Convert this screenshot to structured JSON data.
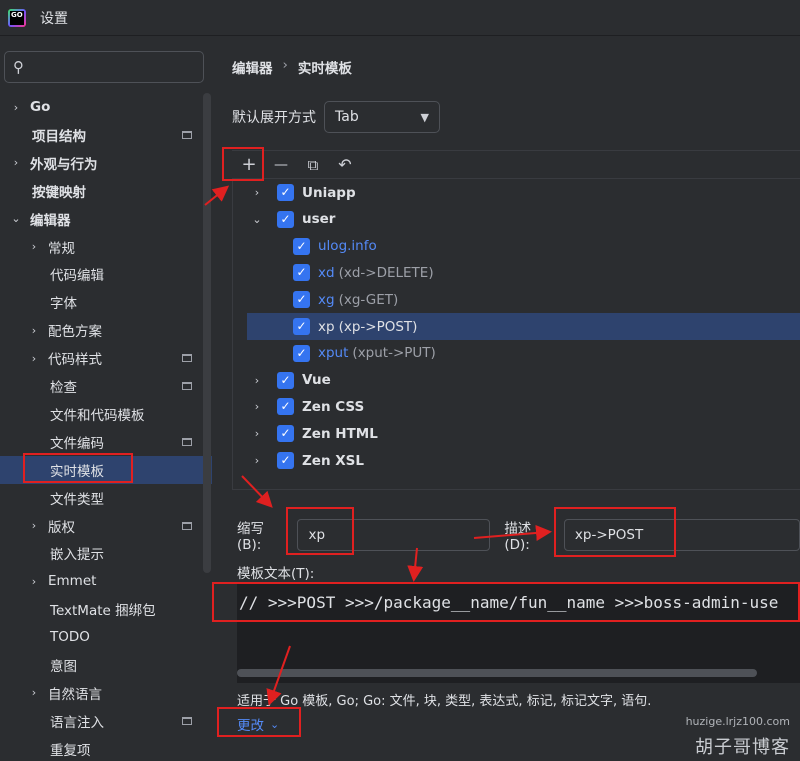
{
  "window": {
    "title": "设置",
    "logo_text": "GO"
  },
  "sidebar": {
    "search_placeholder": "",
    "items": [
      {
        "label": "Go",
        "bold": true,
        "chevron": "›"
      },
      {
        "label": "项目结构",
        "bold": true
      },
      {
        "label": "外观与行为",
        "bold": true,
        "chevron": "›"
      },
      {
        "label": "按键映射",
        "bold": true
      },
      {
        "label": "编辑器",
        "bold": true,
        "chevron": "⌄"
      },
      {
        "label": "常规",
        "chevron": "›"
      },
      {
        "label": "代码编辑"
      },
      {
        "label": "字体"
      },
      {
        "label": "配色方案",
        "chevron": "›"
      },
      {
        "label": "代码样式",
        "chevron": "›"
      },
      {
        "label": "检查"
      },
      {
        "label": "文件和代码模板"
      },
      {
        "label": "文件编码"
      },
      {
        "label": "实时模板"
      },
      {
        "label": "文件类型"
      },
      {
        "label": "版权",
        "chevron": "›"
      },
      {
        "label": "嵌入提示"
      },
      {
        "label": "Emmet",
        "chevron": "›"
      },
      {
        "label": "TextMate 捆绑包"
      },
      {
        "label": "TODO"
      },
      {
        "label": "意图"
      },
      {
        "label": "自然语言",
        "chevron": "›"
      },
      {
        "label": "语言注入"
      },
      {
        "label": "重复项"
      }
    ]
  },
  "breadcrumb": {
    "parent": "编辑器",
    "separator": "›",
    "current": "实时模板"
  },
  "expand": {
    "label": "默认展开方式",
    "value": "Tab"
  },
  "toolbar": {
    "add": "+",
    "remove": "—",
    "copy": "⧉",
    "restore": "↶"
  },
  "templates": {
    "check": "✓",
    "rows": [
      {
        "type": "group",
        "name": "Uniapp",
        "chevron": "›"
      },
      {
        "type": "group",
        "name": "user",
        "chevron": "⌄"
      },
      {
        "type": "leaf",
        "name": "ulog.info",
        "desc": ""
      },
      {
        "type": "leaf",
        "name": "xd",
        "desc": "(xd->DELETE)"
      },
      {
        "type": "leaf",
        "name": "xg",
        "desc": "(xg-GET)"
      },
      {
        "type": "leaf",
        "name": "xp",
        "desc": "(xp->POST)",
        "selected": true
      },
      {
        "type": "leaf",
        "name": "xput",
        "desc": "(xput->PUT)"
      },
      {
        "type": "group",
        "name": "Vue",
        "chevron": "›"
      },
      {
        "type": "group",
        "name": "Zen CSS",
        "chevron": "›"
      },
      {
        "type": "group",
        "name": "Zen HTML",
        "chevron": "›"
      },
      {
        "type": "group",
        "name": "Zen XSL",
        "chevron": "›"
      }
    ]
  },
  "details": {
    "abbr_label": "缩写(B):",
    "abbr_value": "xp",
    "desc_label": "描述(D):",
    "desc_value": "xp->POST",
    "template_text_label": "模板文本(T):",
    "template_text": "// >>>POST >>>/package__name/fun__name >>>boss-admin-use",
    "applies_to": "适用于 Go 模板, Go; Go: 文件, 块, 类型, 表达式, 标记, 标记文字, 语句.",
    "change_label": "更改",
    "change_caret": "⌄"
  },
  "watermark": {
    "url": "huzige.lrjz100.com",
    "name": "胡子哥博客"
  },
  "colors": {
    "accent": "#3574f0",
    "selection": "#2e436e",
    "annotation": "#e02020",
    "link": "#548af7"
  }
}
